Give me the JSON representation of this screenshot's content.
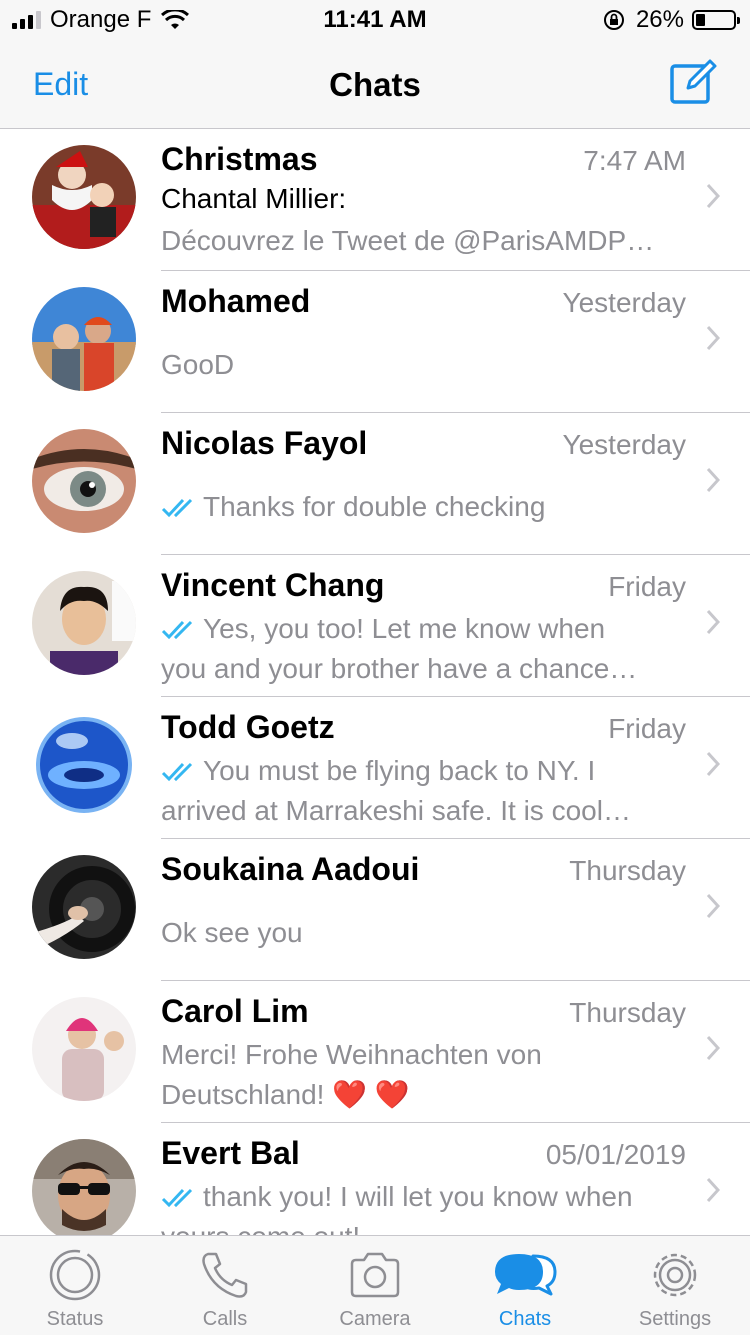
{
  "status_bar": {
    "carrier": "Orange F",
    "time": "11:41 AM",
    "battery": "26%",
    "battery_level": 0.26
  },
  "nav": {
    "edit_label": "Edit",
    "title": "Chats",
    "compose_icon": "compose-icon"
  },
  "accent_color": "#1a8ee6",
  "chats": [
    {
      "name": "Christmas",
      "time": "7:47 AM",
      "sender": "Chantal Millier:",
      "preview": [
        "Découvrez le Tweet de @ParisAMDP…"
      ],
      "read": false
    },
    {
      "name": "Mohamed",
      "time": "Yesterday",
      "preview": [
        "GooD"
      ],
      "read": false
    },
    {
      "name": "Nicolas Fayol",
      "time": "Yesterday",
      "preview": [
        "Thanks for double checking"
      ],
      "read": true
    },
    {
      "name": "Vincent Chang",
      "time": "Friday",
      "preview": [
        "Yes, you too! Let me know when",
        "you and your brother have a chance…"
      ],
      "read": true
    },
    {
      "name": "Todd Goetz",
      "time": "Friday",
      "preview": [
        "You must be flying back to NY. I",
        "arrived at Marrakeshi safe. It is cool…"
      ],
      "read": true
    },
    {
      "name": "Soukaina Aadoui",
      "time": "Thursday",
      "preview": [
        "Ok see you"
      ],
      "read": false
    },
    {
      "name": "Carol Lim",
      "time": "Thursday",
      "preview": [
        "Merci! Frohe Weihnachten von",
        "Deutschland! ❤️ ❤️"
      ],
      "read": false
    },
    {
      "name": "Evert Bal",
      "time": "05/01/2019",
      "preview": [
        "thank you! I will let you know when",
        "yours come out!"
      ],
      "read": true
    }
  ],
  "tabs": [
    {
      "label": "Status",
      "icon": "status-icon",
      "active": false
    },
    {
      "label": "Calls",
      "icon": "phone-icon",
      "active": false
    },
    {
      "label": "Camera",
      "icon": "camera-icon",
      "active": false
    },
    {
      "label": "Chats",
      "icon": "chats-icon",
      "active": true
    },
    {
      "label": "Settings",
      "icon": "gear-icon",
      "active": false
    }
  ]
}
